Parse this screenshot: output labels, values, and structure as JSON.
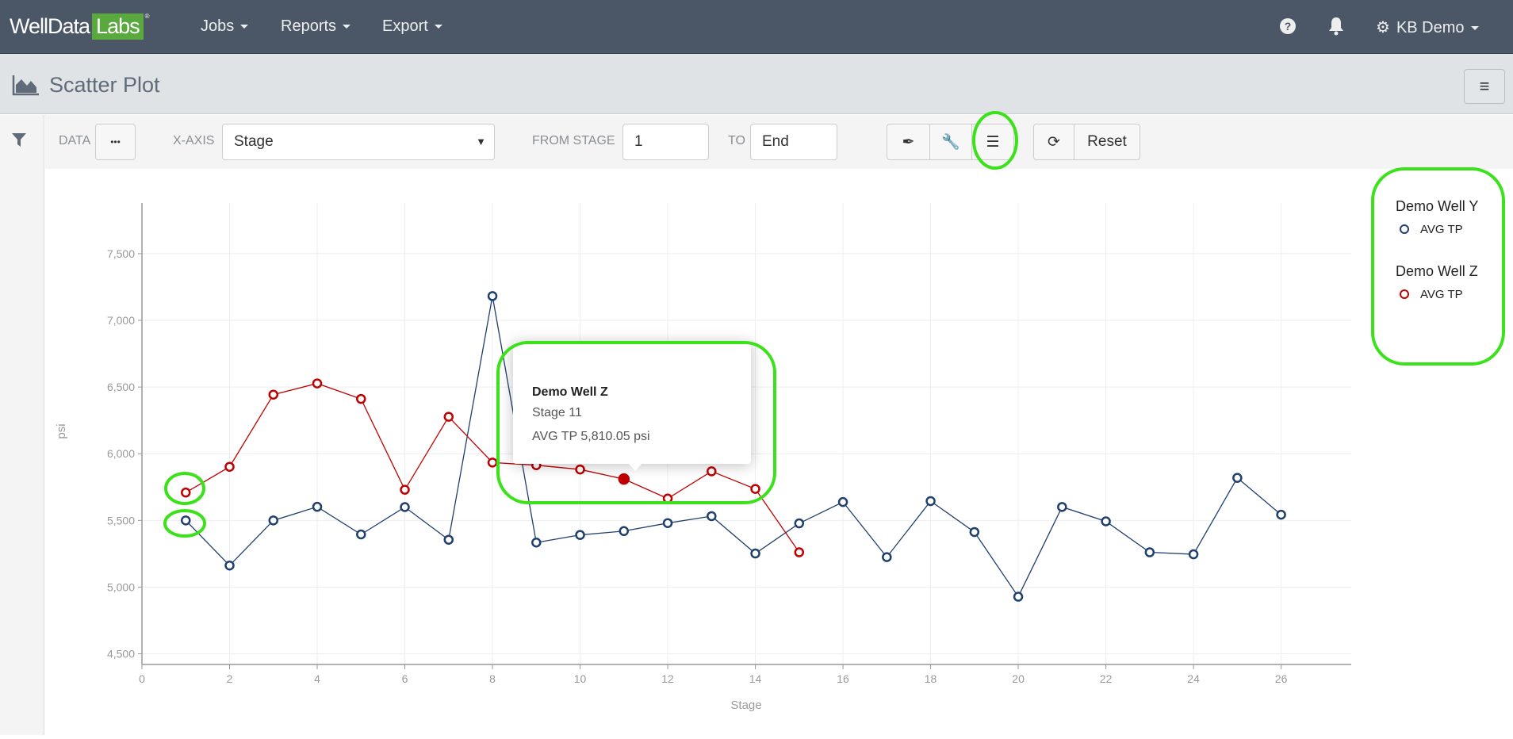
{
  "nav": {
    "logo_a": "WellData",
    "logo_b": "Labs",
    "logo_mark": "®",
    "items": [
      "Jobs",
      "Reports",
      "Export"
    ],
    "user": "KB Demo"
  },
  "page": {
    "title": "Scatter Plot"
  },
  "toolbar": {
    "data_label": "DATA",
    "data_button": "•••",
    "xaxis_label": "X-AXIS",
    "xaxis_value": "Stage",
    "from_label": "FROM STAGE",
    "from_value": "1",
    "to_label": "TO",
    "to_value": "End",
    "reset": "Reset"
  },
  "tooltip": {
    "title": "Demo Well Z",
    "stage": "Stage 11",
    "value": "AVG TP 5,810.05 psi"
  },
  "legend": [
    {
      "name": "Demo Well Y",
      "metric": "AVG TP",
      "color": "#1f3f6e"
    },
    {
      "name": "Demo Well Z",
      "metric": "AVG TP",
      "color": "#c00000"
    }
  ],
  "chart_data": {
    "type": "line",
    "xlabel": "Stage",
    "ylabel": "psi",
    "xlim": [
      0,
      27.6
    ],
    "ylim": [
      4420,
      7880
    ],
    "xticks": [
      "0",
      "2",
      "4",
      "6",
      "8",
      "10",
      "12",
      "14",
      "16",
      "18",
      "20",
      "22",
      "24",
      "26"
    ],
    "yticks": [
      "4,500",
      "5,000",
      "5,500",
      "6,000",
      "6,500",
      "7,000",
      "7,500"
    ],
    "grid": true,
    "legend_position": "right",
    "series": [
      {
        "name": "Demo Well Y - AVG TP",
        "color": "#1f3f6e",
        "x": [
          1,
          2,
          3,
          4,
          5,
          6,
          7,
          8,
          9,
          10,
          11,
          12,
          13,
          14,
          15,
          16,
          17,
          18,
          19,
          20,
          21,
          22,
          23,
          24,
          25,
          26
        ],
        "y": [
          5500,
          5162,
          5500,
          5602,
          5395,
          5600,
          5355,
          7182,
          5334,
          5391,
          5420,
          5480,
          5532,
          5252,
          5478,
          5638,
          5225,
          5645,
          5413,
          4928,
          5601,
          5493,
          5261,
          5246,
          5819,
          5543
        ]
      },
      {
        "name": "Demo Well Z - AVG TP",
        "color": "#c00000",
        "x": [
          1,
          2,
          3,
          4,
          5,
          6,
          7,
          8,
          9,
          10,
          11,
          12,
          13,
          14,
          15
        ],
        "y": [
          5709,
          5902,
          6443,
          6527,
          6411,
          5730,
          6277,
          5934,
          5914,
          5882,
          5810.05,
          5664,
          5868,
          5736,
          5261
        ]
      }
    ],
    "highlighted": {
      "series": 1,
      "x": 11
    }
  }
}
